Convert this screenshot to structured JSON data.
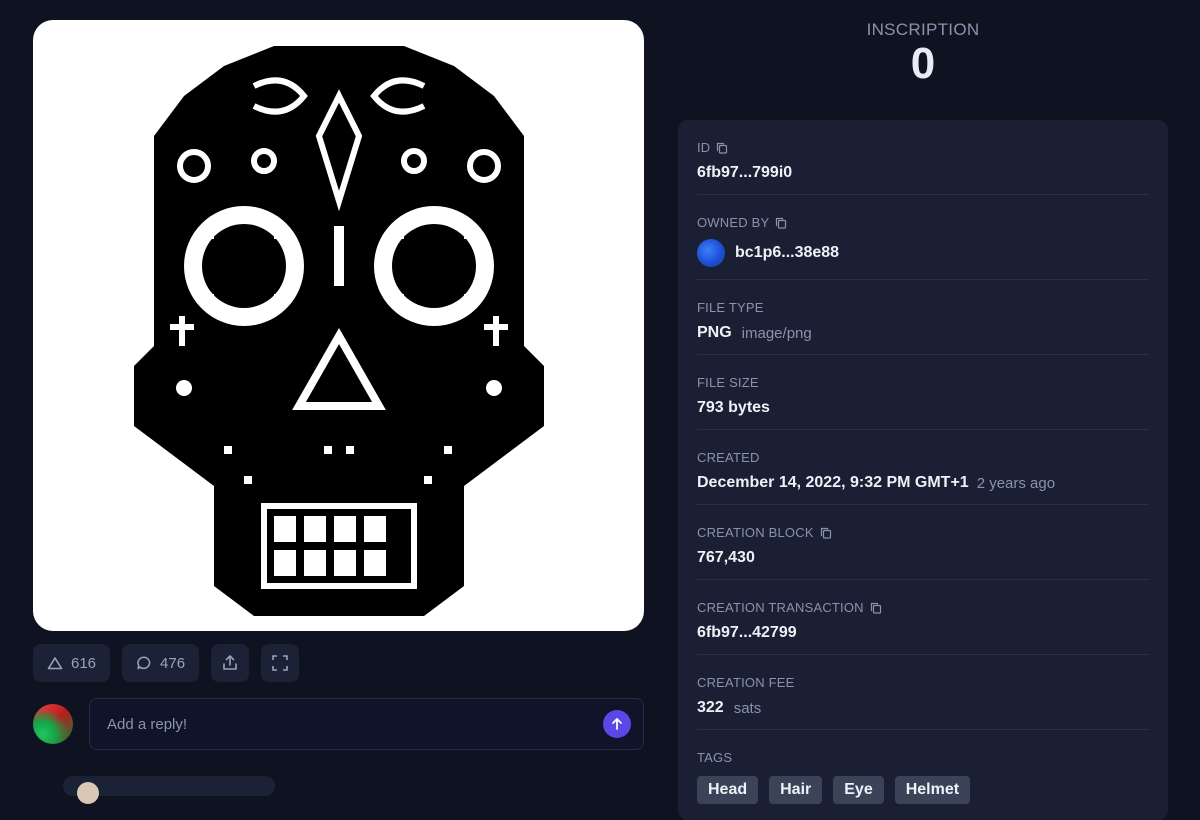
{
  "actions": {
    "likes": "616",
    "comments": "476"
  },
  "reply": {
    "placeholder": "Add a reply!"
  },
  "inscription": {
    "label": "INSCRIPTION",
    "number": "0"
  },
  "details": {
    "id": {
      "label": "ID",
      "value": "6fb97...799i0"
    },
    "owned_by": {
      "label": "OWNED BY",
      "value": "bc1p6...38e88"
    },
    "file_type": {
      "label": "FILE TYPE",
      "value": "PNG",
      "sub": "image/png"
    },
    "file_size": {
      "label": "FILE SIZE",
      "value": "793 bytes"
    },
    "created": {
      "label": "CREATED",
      "value": "December 14, 2022, 9:32 PM GMT+1",
      "sub": "2 years ago"
    },
    "creation_block": {
      "label": "CREATION BLOCK",
      "value": "767,430"
    },
    "creation_tx": {
      "label": "CREATION TRANSACTION",
      "value": "6fb97...42799"
    },
    "creation_fee": {
      "label": "CREATION FEE",
      "value": "322",
      "sub": "sats"
    },
    "tags": {
      "label": "TAGS",
      "items": [
        "Head",
        "Hair",
        "Eye",
        "Helmet"
      ]
    }
  },
  "colors": {
    "background": "#0f1221",
    "card": "#1a1f33",
    "accent": "#5a47e6",
    "muted": "#8a92ad"
  },
  "icons": [
    "triangle-up-icon",
    "comment-bubble-icon",
    "share-upload-icon",
    "fullscreen-icon",
    "arrow-up-icon",
    "copy-icon"
  ]
}
